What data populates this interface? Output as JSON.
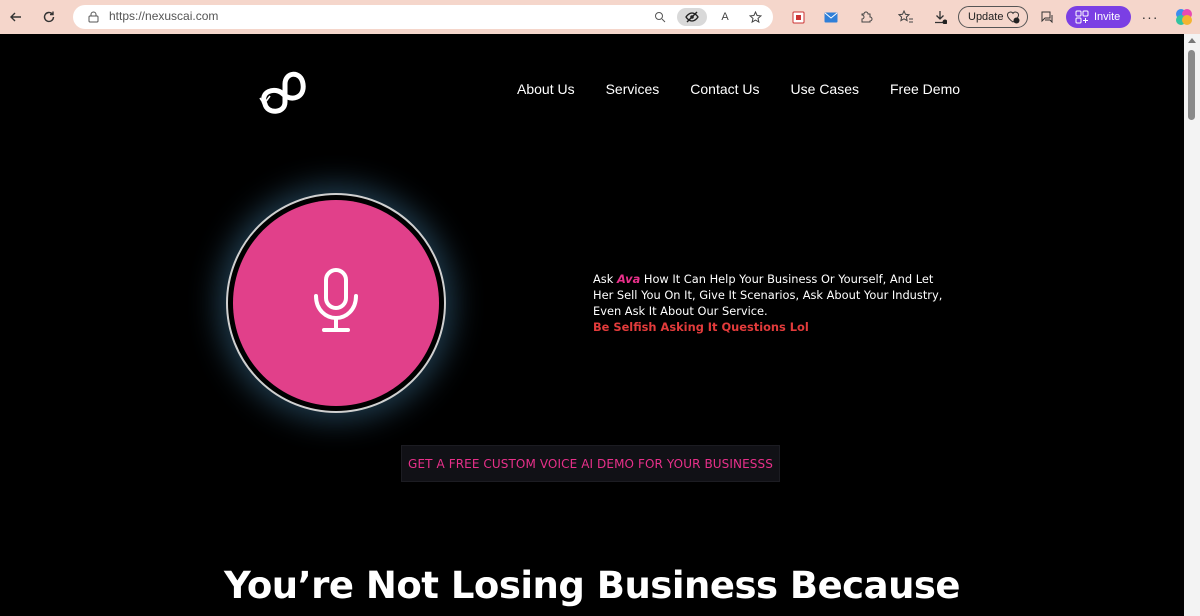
{
  "browser": {
    "url": "https://nexuscai.com",
    "update_label": "Update",
    "invite_label": "Invite",
    "icons": [
      "back-icon",
      "refresh-icon",
      "lock-icon",
      "zoom-icon",
      "tracking-prevention-icon",
      "read-aloud-icon",
      "favorite-icon",
      "extension-icon",
      "mail-icon",
      "puzzle-icon",
      "favorites-bar-icon",
      "download-icon",
      "update-badge-icon",
      "chat-icon",
      "invite-people-icon",
      "more-icon",
      "copilot-icon"
    ]
  },
  "nav": {
    "items": [
      "About Us",
      "Services",
      "Contact Us",
      "Use Cases",
      "Free Demo"
    ]
  },
  "hero": {
    "text_prefix": "Ask ",
    "assistant_name": "Ava",
    "text_body": " How It Can Help Your Business Or Yourself, And Let Her Sell You On It, Give It Scenarios, Ask About Your Industry, Even Ask It About Our Service.",
    "tagline": "Be Selfish Asking It Questions Lol",
    "cta_label": "GET A FREE CUSTOM VOICE AI DEMO FOR YOUR BUSINESSS"
  },
  "headline": "You’re Not Losing Business Because",
  "colors": {
    "accent_pink": "#e1408a",
    "cta_text": "#e8308a",
    "tagline_red": "#e23b3b",
    "invite_purple": "#7b3fe4"
  }
}
